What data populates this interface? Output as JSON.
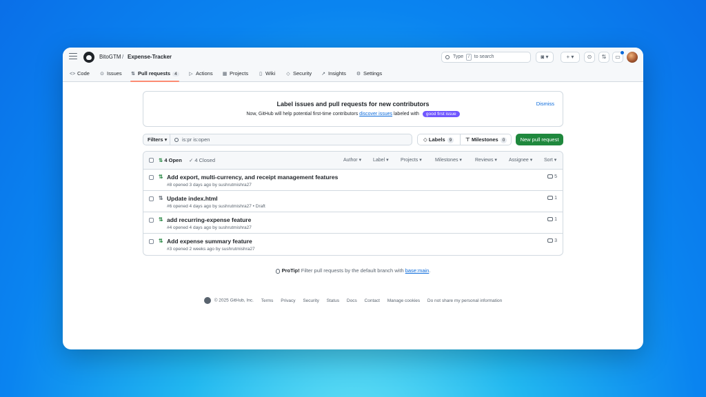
{
  "header": {
    "owner": "BitoGTM",
    "separator": "/",
    "repo": "Expense-Tracker",
    "search": {
      "prefix": "Type",
      "key": "/",
      "suffix": "to search"
    }
  },
  "tabs": [
    {
      "label": "Code",
      "icon": "code-icon"
    },
    {
      "label": "Issues",
      "icon": "issue-icon"
    },
    {
      "label": "Pull requests",
      "icon": "pull-request-icon",
      "count": "4",
      "active": true
    },
    {
      "label": "Actions",
      "icon": "play-icon"
    },
    {
      "label": "Projects",
      "icon": "table-icon"
    },
    {
      "label": "Wiki",
      "icon": "book-icon"
    },
    {
      "label": "Security",
      "icon": "shield-icon"
    },
    {
      "label": "Insights",
      "icon": "graph-icon"
    },
    {
      "label": "Settings",
      "icon": "gear-icon"
    }
  ],
  "banner": {
    "title": "Label issues and pull requests for new contributors",
    "text_before": "Now, GitHub will help potential first-time contributors",
    "link": "discover issues",
    "text_after": "labeled with",
    "label": "good first issue",
    "label_color": "#7057ff",
    "dismiss": "Dismiss"
  },
  "filters": {
    "button": "Filters",
    "query": "is:pr is:open",
    "labels": "Labels",
    "labels_count": "9",
    "milestones": "Milestones",
    "milestones_count": "0",
    "new_pr": "New pull request",
    "new_pr_color": "#1f883d"
  },
  "list": {
    "open": "4 Open",
    "closed": "4 Closed",
    "sorters": [
      "Author",
      "Label",
      "Projects",
      "Milestones",
      "Reviews",
      "Assignee",
      "Sort"
    ],
    "rows": [
      {
        "title": "Add export, multi-currency, and receipt management features",
        "meta": "#8 opened 3 days ago by sushrutmishra27",
        "comments": "5",
        "draft": false
      },
      {
        "title": "Update index.html",
        "meta": "#6 opened 4 days ago by sushrutmishra27 • Draft",
        "comments": "1",
        "draft": true
      },
      {
        "title": "add recurring-expense feature",
        "meta": "#4 opened 4 days ago by sushrutmishra27",
        "comments": "1",
        "draft": false
      },
      {
        "title": "Add expense summary feature",
        "meta": "#3 opened 2 weeks ago by sushrutmishra27",
        "comments": "3",
        "draft": false
      }
    ]
  },
  "protip": {
    "label": "ProTip!",
    "text": "Filter pull requests by the default branch with",
    "link": "base:main",
    "end": "."
  },
  "footer": {
    "copyright": "© 2025 GitHub, Inc.",
    "links": [
      "Terms",
      "Privacy",
      "Security",
      "Status",
      "Docs",
      "Contact",
      "Manage cookies",
      "Do not share my personal information"
    ]
  }
}
